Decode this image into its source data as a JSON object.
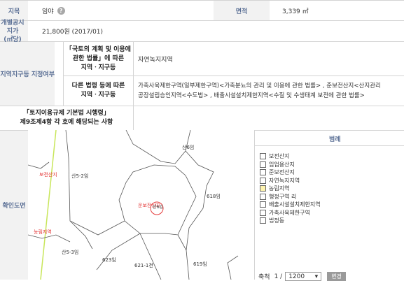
{
  "rows": {
    "jimok_label": "지목",
    "jimok_value": "임야",
    "area_label": "면적",
    "area_value": "3,339 ㎡",
    "price_label": "개별공시지가\n(㎡당)",
    "price_value": "21,800원 (2017/01)",
    "zone_label": "지역지구등 지정여부",
    "law1_label": "「국토의 계획 및 이용에\n관한 법률」에 따른\n지역ㆍ지구등",
    "law1_value": "자연녹지지역",
    "law2_label": "다른 법령 등에 따른\n지역ㆍ지구등",
    "law2_value_line1": "가축사육제한구역(일부제한구역)<가축분뇨의 관리 및 이용에 관한 법률> , 준보전산지<산지관리",
    "law2_value_line2": "공장설립승인지역<수도법> , 배출시설설치제한지역<수질 및 수생태계 보전에 관한 법률>",
    "rule_label": "「토지이용규제 기본법 시행령」\n제9조제4항 각 호에 해당되는 사항",
    "map_label": "확인도면"
  },
  "map": {
    "labels": [
      "산6임",
      "산5-2임",
      "618임",
      "산5-3임",
      "623임",
      "621-1전",
      "619임"
    ],
    "center_label": "운보전산지",
    "center_sub": "산6임",
    "zone_left1": "보전산지",
    "zone_left2": "농림지역"
  },
  "legend": {
    "title": "범례",
    "items": [
      {
        "label": "보전산지",
        "color": "#ffffff"
      },
      {
        "label": "임업용산지",
        "color": "#ffffff"
      },
      {
        "label": "준보전산지",
        "color": "#ffffff"
      },
      {
        "label": "자연녹지지역",
        "color": "#ffffff"
      },
      {
        "label": "농림지역",
        "color": "#fff4b0"
      },
      {
        "label": "행정구역 리",
        "color": "#ffffff"
      },
      {
        "label": "배출시설설치제한지역",
        "color": "#ffffff"
      },
      {
        "label": "가축사육제한구역",
        "color": "#ffffff"
      },
      {
        "label": "법정동",
        "color": "#ffffff"
      }
    ]
  },
  "controls": {
    "scale_label": "축척",
    "scale_prefix": "1 /",
    "scale_value": "1200",
    "change_button": "변경"
  }
}
